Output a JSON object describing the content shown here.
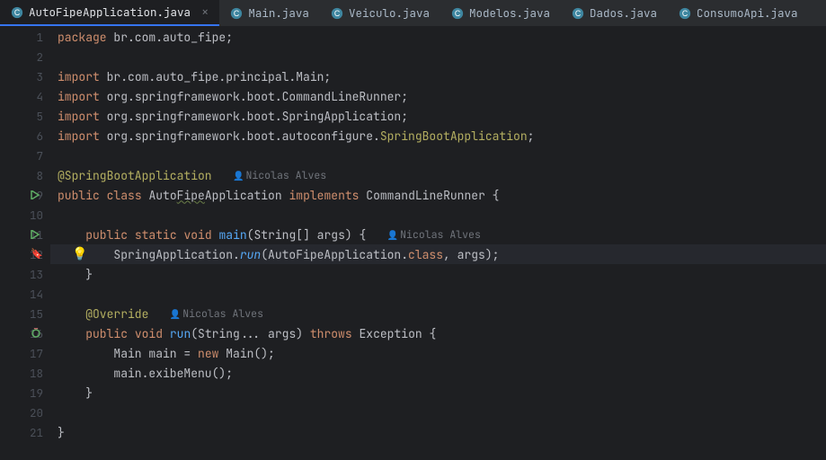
{
  "tabs": [
    {
      "label": "AutoFipeApplication.java",
      "active": true
    },
    {
      "label": "Main.java",
      "active": false
    },
    {
      "label": "Veiculo.java",
      "active": false
    },
    {
      "label": "Modelos.java",
      "active": false
    },
    {
      "label": "Dados.java",
      "active": false
    },
    {
      "label": "ConsumoApi.java",
      "active": false
    }
  ],
  "author": "Nicolas Alves",
  "code": {
    "pkg_kw": "package",
    "pkg_path": " br.com.auto_fipe;",
    "import_kw": "import",
    "imp1": " br.com.auto_fipe.principal.Main;",
    "imp2": " org.springframework.boot.CommandLineRunner;",
    "imp3": " org.springframework.boot.SpringApplication;",
    "imp4_a": " org.springframework.boot.autoconfigure.",
    "imp4_b": "SpringBootApplication",
    "imp4_c": ";",
    "anno": "@SpringBootApplication",
    "public_kw": "public",
    "class_kw": "class",
    "static_kw": "static",
    "void_kw": "void",
    "new_kw": "new",
    "throws_kw": "throws",
    "impl_kw": "implements",
    "clsname_a": " Auto",
    "clsname_b": "Fipe",
    "clsname_c": "Application ",
    "runner": " CommandLineRunner {",
    "main_fn": "main",
    "main_args": "(String[] args) {",
    "spring_app": "SpringApplication.",
    "run_fn": "run",
    "run_args_a": "(AutoFipeApplication.",
    "run_args_b": "class",
    "run_args_c": ", args);",
    "override": "@Override",
    "run2_args": "(String... args) ",
    "exception": " Exception {",
    "main_inst": "Main main = ",
    "main_ctor": " Main();",
    "exibe": "main.exibeMenu();",
    "brace_close": "}",
    "indent1": "    ",
    "indent2": "        "
  }
}
